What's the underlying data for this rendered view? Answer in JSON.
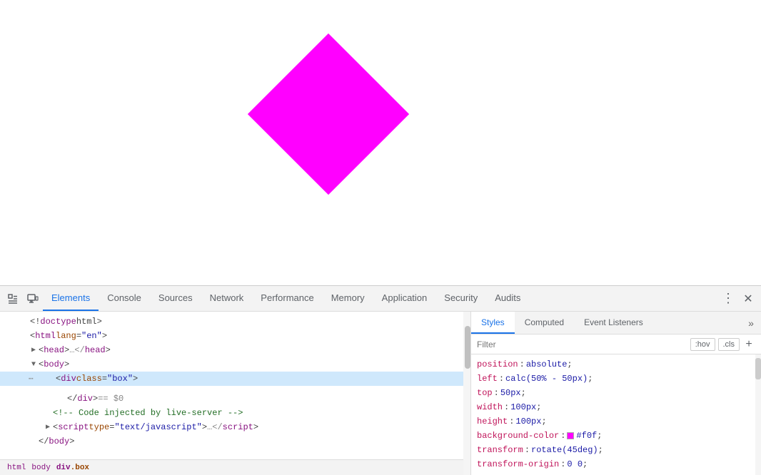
{
  "viewport": {
    "diamond_color": "#ff00ff"
  },
  "devtools": {
    "toolbar": {
      "inspect_icon": "⊡",
      "device_icon": "⬜",
      "more_icon": "⋮",
      "close_icon": "✕"
    },
    "tabs": [
      {
        "id": "elements",
        "label": "Elements",
        "active": true
      },
      {
        "id": "console",
        "label": "Console",
        "active": false
      },
      {
        "id": "sources",
        "label": "Sources",
        "active": false
      },
      {
        "id": "network",
        "label": "Network",
        "active": false
      },
      {
        "id": "performance",
        "label": "Performance",
        "active": false
      },
      {
        "id": "memory",
        "label": "Memory",
        "active": false
      },
      {
        "id": "application",
        "label": "Application",
        "active": false
      },
      {
        "id": "security",
        "label": "Security",
        "active": false
      },
      {
        "id": "audits",
        "label": "Audits",
        "active": false
      }
    ],
    "html_panel": {
      "lines": [
        {
          "id": 1,
          "indent": 0,
          "content": "<!doctype html>",
          "type": "doctype",
          "selected": false,
          "dots": false
        },
        {
          "id": 2,
          "indent": 0,
          "content_parts": [
            {
              "type": "bracket",
              "text": "<"
            },
            {
              "type": "tag",
              "text": "html"
            },
            {
              "type": "attr-name",
              "text": " lang"
            },
            {
              "type": "equals",
              "text": "="
            },
            {
              "type": "attr-value",
              "text": "\"en\""
            },
            {
              "type": "bracket",
              "text": ">"
            }
          ],
          "selected": false,
          "dots": false
        },
        {
          "id": 3,
          "indent": 1,
          "content_parts": [
            {
              "type": "triangle",
              "text": "▶"
            },
            {
              "type": "bracket",
              "text": "<"
            },
            {
              "type": "tag",
              "text": "head"
            },
            {
              "type": "bracket",
              "text": "…</"
            },
            {
              "type": "tag",
              "text": "head"
            },
            {
              "type": "bracket",
              "text": ">"
            }
          ],
          "selected": false,
          "dots": false
        },
        {
          "id": 4,
          "indent": 1,
          "content_parts": [
            {
              "type": "triangle",
              "text": "▼"
            },
            {
              "type": "bracket",
              "text": "<"
            },
            {
              "type": "tag",
              "text": "body"
            },
            {
              "type": "bracket",
              "text": ">"
            }
          ],
          "selected": false,
          "dots": false
        },
        {
          "id": 5,
          "indent": 2,
          "content_parts": [
            {
              "type": "bracket",
              "text": "<"
            },
            {
              "type": "tag",
              "text": "div"
            },
            {
              "type": "attr-name",
              "text": " class"
            },
            {
              "type": "equals",
              "text": "="
            },
            {
              "type": "attr-value",
              "text": "\"box\""
            },
            {
              "type": "bracket",
              "text": ">"
            }
          ],
          "selected": true,
          "dots": true
        },
        {
          "id": 6,
          "indent": 0,
          "content_parts": [],
          "selected": false,
          "dots": false
        },
        {
          "id": 7,
          "indent": 3,
          "content_parts": [
            {
              "type": "bracket",
              "text": "</"
            },
            {
              "type": "tag",
              "text": "div"
            },
            {
              "type": "bracket",
              "text": ">"
            },
            {
              "type": "grey",
              "text": " == $0"
            }
          ],
          "selected": false,
          "dots": false
        },
        {
          "id": 8,
          "indent": 2,
          "content_parts": [
            {
              "type": "comment",
              "text": "<!-- Code injected by live-server -->"
            }
          ],
          "selected": false,
          "dots": false
        },
        {
          "id": 9,
          "indent": 2,
          "content_parts": [
            {
              "type": "triangle",
              "text": "▶"
            },
            {
              "type": "bracket",
              "text": "<"
            },
            {
              "type": "tag",
              "text": "script"
            },
            {
              "type": "attr-name",
              "text": " type"
            },
            {
              "type": "equals",
              "text": "="
            },
            {
              "type": "attr-value",
              "text": "\"text/javascript\""
            },
            {
              "type": "bracket",
              "text": ">…</"
            },
            {
              "type": "tag",
              "text": "script"
            },
            {
              "type": "bracket",
              "text": ">"
            }
          ],
          "selected": false,
          "dots": false
        },
        {
          "id": 10,
          "indent": 1,
          "content_parts": [
            {
              "type": "bracket",
              "text": "</"
            },
            {
              "type": "tag",
              "text": "body"
            },
            {
              "type": "bracket",
              "text": ">"
            }
          ],
          "selected": false,
          "dots": false
        }
      ],
      "breadcrumb": [
        {
          "label": "html",
          "type": "tag"
        },
        {
          "sep": " "
        },
        {
          "label": "body",
          "type": "tag"
        },
        {
          "sep": " "
        },
        {
          "label": "div",
          "type": "tag"
        },
        {
          "label": ".box",
          "type": "class"
        }
      ]
    },
    "styles_panel": {
      "tabs": [
        {
          "id": "styles",
          "label": "Styles",
          "active": true
        },
        {
          "id": "computed",
          "label": "Computed",
          "active": false
        },
        {
          "id": "event-listeners",
          "label": "Event Listeners",
          "active": false
        }
      ],
      "filter_placeholder": "Filter",
      "hov_label": ":hov",
      "cls_label": ".cls",
      "add_label": "+",
      "css_lines": [
        {
          "prop": "position",
          "value": "absolute",
          "color": null
        },
        {
          "prop": "left",
          "value": "calc(50% - 50px)",
          "color": null
        },
        {
          "prop": "top",
          "value": "50px",
          "color": null
        },
        {
          "prop": "width",
          "value": "100px",
          "color": null
        },
        {
          "prop": "height",
          "value": "100px",
          "color": null
        },
        {
          "prop": "background-color",
          "value": "#f0f",
          "color": "#ff00ff"
        },
        {
          "prop": "transform",
          "value": "rotate(45deg)",
          "color": null
        },
        {
          "prop": "transform-origin",
          "value": "0 0",
          "color": null
        }
      ]
    }
  }
}
